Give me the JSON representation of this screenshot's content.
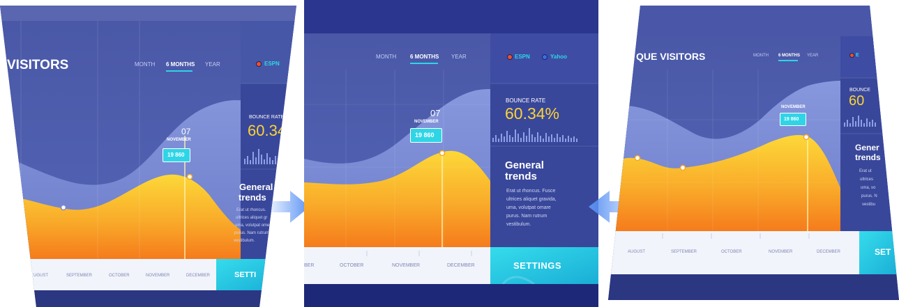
{
  "left": {
    "title": "VISITORS",
    "tabs": [
      {
        "label": "MONTH"
      },
      {
        "label": "6 MONTHS"
      },
      {
        "label": "YEAR"
      }
    ],
    "legend": [
      {
        "label": "ESPN",
        "color": "#f0502a"
      }
    ],
    "tooltip": {
      "day": "07",
      "month": "NOVEMBER",
      "value": "19 860"
    },
    "bounce": {
      "label": "BOUNCE RATE",
      "value": "60.34"
    },
    "trends": {
      "title_line1": "General",
      "title_line2": "trends",
      "body": [
        "Erat ut rhoncus.",
        "ultrices aliquet gr",
        "uma, volutpat ome",
        "purus. Nam rutrum",
        "vestibulum."
      ]
    },
    "months": [
      "UGUST",
      "SEPTEMBER",
      "OCTOBER",
      "NOVEMBER",
      "DECEMBER"
    ],
    "settings_label": "SETTI"
  },
  "center": {
    "tabs": [
      {
        "label": "MONTH"
      },
      {
        "label": "6 MONTHS"
      },
      {
        "label": "YEAR"
      }
    ],
    "legend": [
      {
        "label": "ESPN",
        "color": "#f0502a"
      },
      {
        "label": "Yahoo",
        "color": "#3b6cf0"
      }
    ],
    "tooltip": {
      "day": "07",
      "month": "NOVEMBER",
      "value": "19 860"
    },
    "bounce": {
      "label": "BOUNCE RATE",
      "value": "60.34%"
    },
    "trends": {
      "title_line1": "General",
      "title_line2": "trends",
      "body": [
        "Erat ut rhoncus. Fusce",
        "ultrices aliquet gravida,",
        "uma, volutpat omare",
        "purus. Nam rutrum",
        "vestibulum."
      ]
    },
    "months": [
      "BER",
      "OCTOBER",
      "NOVEMBER",
      "DECEMBER"
    ],
    "settings_label": "SETTINGS"
  },
  "right": {
    "title": "QUE VISITORS",
    "tabs": [
      {
        "label": "MONTH"
      },
      {
        "label": "6 MONTHS"
      },
      {
        "label": "YEAR"
      }
    ],
    "legend": [
      {
        "label": "E",
        "color": "#f0502a"
      }
    ],
    "tooltip": {
      "month": "NOVEMBER",
      "value": "19 860"
    },
    "bounce": {
      "label": "BOUNCE",
      "value": "60"
    },
    "trends": {
      "title_line1": "Gener",
      "title_line2": "trends",
      "body": [
        "Erat ut",
        "ultrices",
        "uma, vo",
        "purus. N",
        "vestibu"
      ]
    },
    "months": [
      "AUGUST",
      "SEPTEMBER",
      "OCTOBER",
      "NOVEMBER",
      "DECEMBER"
    ],
    "settings_label": "SET"
  },
  "colors": {
    "page": "#ffffff",
    "panel_bg": "#3a4796",
    "sidebar_bg": "#39479a",
    "accent": "#2fd5e6",
    "area_top": "#fbd335",
    "area_bottom": "#f58a1e",
    "value_text": "#fbd335",
    "arrow": "#5b93f4"
  },
  "icons": {
    "arrow_left": "arrow-right-icon",
    "arrow_right": "arrow-left-icon"
  }
}
